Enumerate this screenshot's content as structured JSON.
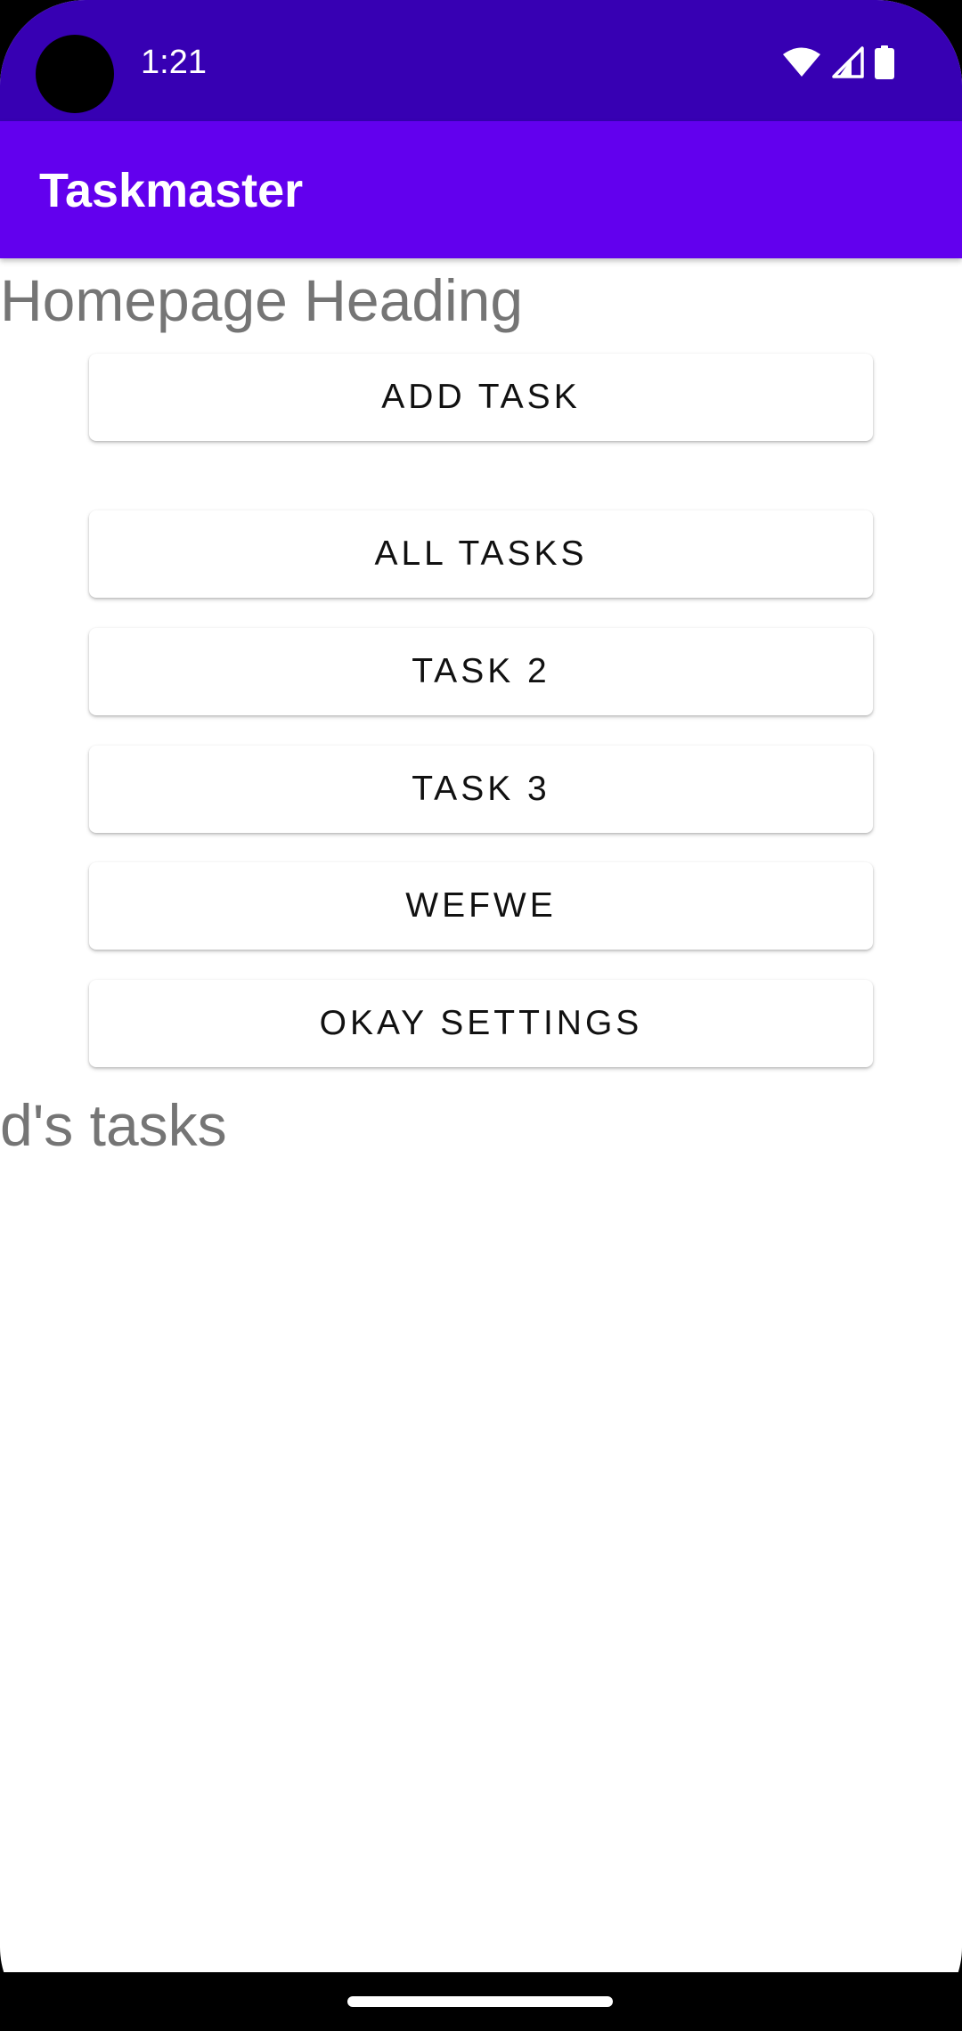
{
  "status_bar": {
    "time": "1:21",
    "background_color": "#3700b3",
    "icons": [
      "wifi-icon",
      "signal-icon",
      "battery-icon"
    ]
  },
  "app_bar": {
    "title": "Taskmaster",
    "background_color": "#6200ee"
  },
  "main": {
    "heading": "Homepage Heading",
    "buttons": {
      "add_task": "Add Task",
      "all_tasks": "All Tasks",
      "task_2": "Task 2",
      "task_3": "Task 3",
      "wefwe": "wefwe",
      "okay_settings": "okay settings"
    },
    "user_tasks_label": "d's tasks"
  },
  "nav_bar": {
    "handle": "home-handle"
  }
}
